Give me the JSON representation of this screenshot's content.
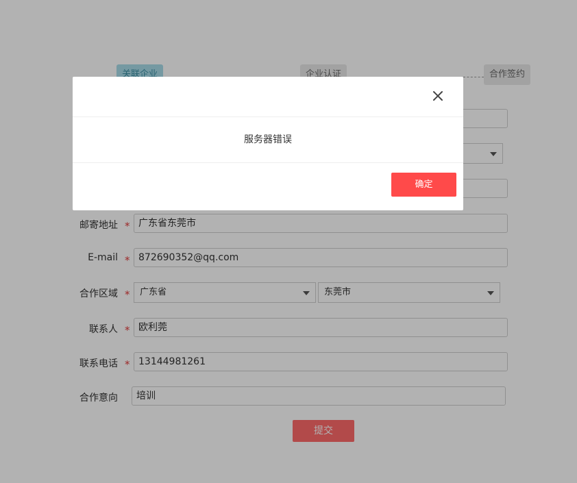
{
  "steps": {
    "step1": "关联企业",
    "step2": "企业认证",
    "step3": "合作签约"
  },
  "form": {
    "mailing_address": {
      "label": "邮寄地址",
      "value": "广东省东莞市"
    },
    "email": {
      "label": "E-mail",
      "value": "872690352@qq.com"
    },
    "region": {
      "label": "合作区域",
      "province": "广东省",
      "city": "东莞市"
    },
    "contact": {
      "label": "联系人",
      "value": "欧利莞"
    },
    "phone": {
      "label": "联系电话",
      "value": "13144981261"
    },
    "intention": {
      "label": "合作意向",
      "value": "培训"
    },
    "required_mark": "*",
    "submit_label": "提交"
  },
  "modal": {
    "message": "服务器错误",
    "confirm_label": "确定",
    "close_icon": "close-icon"
  },
  "colors": {
    "primary_red": "#ff4a4a",
    "submit_red": "#ff6a6a",
    "required": "#e03b3b",
    "active_step": "#a8dbe9"
  }
}
